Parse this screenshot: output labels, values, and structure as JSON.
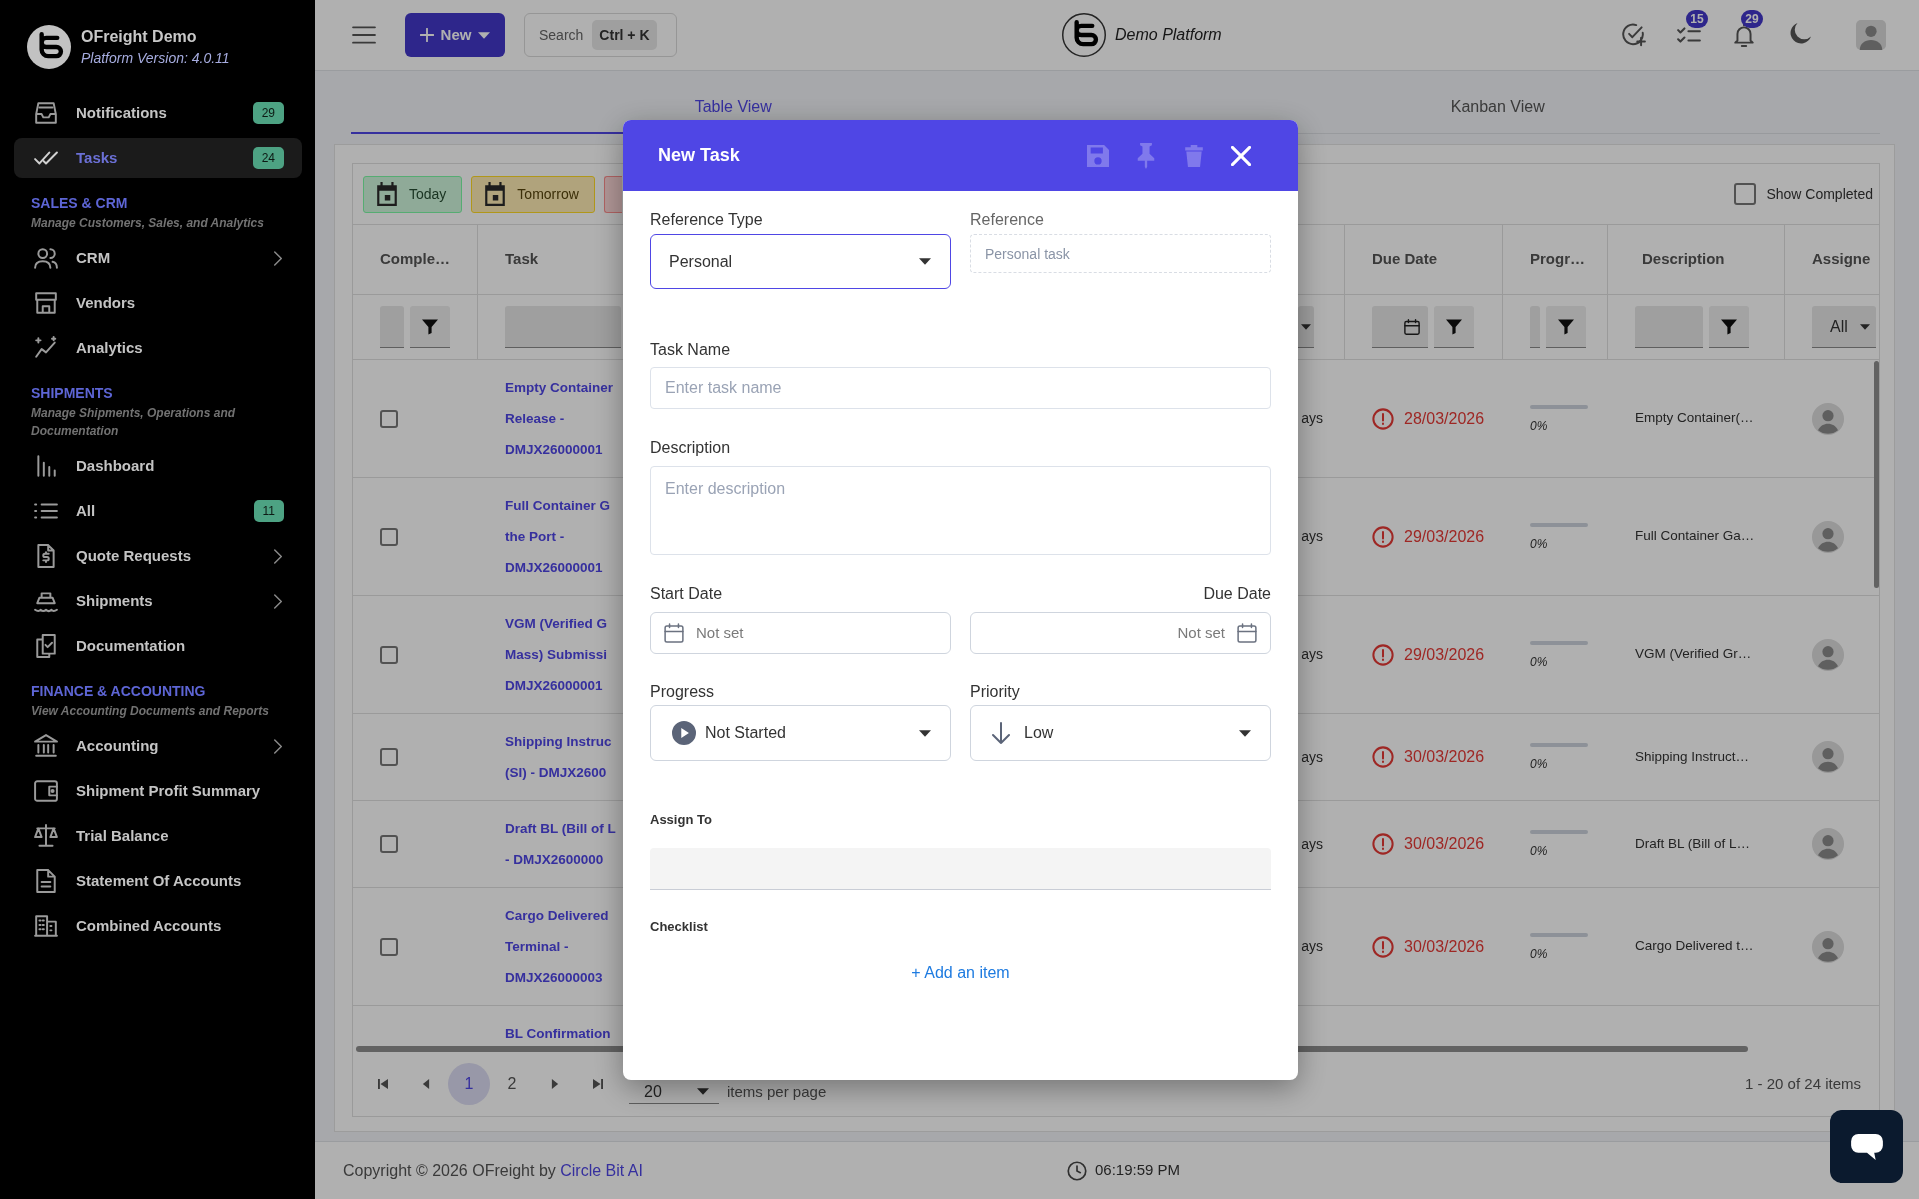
{
  "sidebar": {
    "brand": {
      "title": "OFreight Demo",
      "version": "Platform Version: 4.0.11"
    },
    "sections": [
      {
        "items": [
          {
            "label": "Notifications",
            "badge": "29",
            "selected": false,
            "submenu": false
          },
          {
            "label": "Tasks",
            "badge": "24",
            "selected": true,
            "submenu": false
          }
        ]
      },
      {
        "heading": "SALES & CRM",
        "subtitle": "Manage Customers, Sales, and Analytics",
        "items": [
          {
            "label": "CRM",
            "selected": false,
            "submenu": true
          },
          {
            "label": "Vendors",
            "selected": false,
            "submenu": false
          },
          {
            "label": "Analytics",
            "selected": false,
            "submenu": false
          }
        ]
      },
      {
        "heading": "SHIPMENTS",
        "subtitle": "Manage Shipments, Operations and Documentation",
        "items": [
          {
            "label": "Dashboard",
            "selected": false,
            "submenu": false
          },
          {
            "label": "All",
            "badge": "11",
            "selected": false,
            "submenu": false
          },
          {
            "label": "Quote Requests",
            "selected": false,
            "submenu": true
          },
          {
            "label": "Shipments",
            "selected": false,
            "submenu": true
          },
          {
            "label": "Documentation",
            "selected": false,
            "submenu": false
          }
        ]
      },
      {
        "heading": "FINANCE & ACCOUNTING",
        "subtitle": "View Accounting Documents and Reports",
        "items": [
          {
            "label": "Accounting",
            "selected": false,
            "submenu": true
          },
          {
            "label": "Shipment Profit Summary",
            "selected": false,
            "submenu": false
          },
          {
            "label": "Trial Balance",
            "selected": false,
            "submenu": false
          },
          {
            "label": "Statement Of Accounts",
            "selected": false,
            "submenu": false
          },
          {
            "label": "Combined Accounts",
            "selected": false,
            "submenu": false
          }
        ]
      }
    ]
  },
  "top_bar": {
    "new_button": "New",
    "search": {
      "label": "Search",
      "shortcut": "Ctrl + K"
    },
    "brand": "Demo Platform",
    "task_badge": "15",
    "notification_badge": "29"
  },
  "tabs": [
    {
      "label": "Table View",
      "selected": true
    },
    {
      "label": "Kanban View",
      "selected": false
    }
  ],
  "grid": {
    "quick_filters": [
      {
        "label": "Today",
        "color": "#8faa98"
      },
      {
        "label": "Tomorrow",
        "color": "#b0a37c"
      },
      {
        "color": "#b09696"
      }
    ],
    "show_completed": {
      "label": "Show Completed",
      "checked": false
    },
    "columns": [
      {
        "label": "Comple…",
        "filter": {
          "kind": "field_funnel"
        }
      },
      {
        "label": "Task",
        "filter": {
          "kind": "field"
        }
      },
      {
        "filter": {
          "kind": "dropdown"
        }
      },
      {
        "label": "Due Date",
        "filter": {
          "kind": "date_funnel"
        }
      },
      {
        "label": "Progr…",
        "filter": {
          "kind": "field_funnel"
        }
      },
      {
        "label": "Description",
        "filter": {
          "kind": "field_funnel"
        }
      },
      {
        "label": "Assigne",
        "filter": {
          "kind": "dropdown",
          "value": "All"
        }
      }
    ],
    "rows": [
      {
        "completed": false,
        "task": "Empty Container Release - DMJX26000001",
        "column_3": "ays",
        "overdue": true,
        "due_date": "28/03/2026",
        "progress": {
          "level": 0,
          "reading": "0%"
        },
        "description": "Empty Container(…"
      },
      {
        "completed": false,
        "task": "Full Container G the Port - DMJX26000001",
        "column_3": "ays",
        "overdue": true,
        "due_date": "29/03/2026",
        "progress": {
          "level": 0,
          "reading": "0%"
        },
        "description": "Full Container Ga…"
      },
      {
        "completed": false,
        "task": "VGM (Verified G Mass) Submissi DMJX26000001",
        "column_3": "ays",
        "overdue": true,
        "due_date": "29/03/2026",
        "progress": {
          "level": 0,
          "reading": "0%"
        },
        "description": "VGM (Verified Gr…"
      },
      {
        "completed": false,
        "task": "Shipping Instruc (SI) - DMJX2600",
        "column_3": "ays",
        "overdue": true,
        "due_date": "30/03/2026",
        "progress": {
          "level": 0,
          "reading": "0%"
        },
        "description": "Shipping Instruct…"
      },
      {
        "completed": false,
        "task": "Draft BL (Bill of L - DMJX2600000",
        "column_3": "ays",
        "overdue": true,
        "due_date": "30/03/2026",
        "progress": {
          "level": 0,
          "reading": "0%"
        },
        "description": "Draft BL (Bill of L…"
      },
      {
        "completed": false,
        "task": "Cargo Delivered Terminal - DMJX26000003",
        "column_3": "ays",
        "overdue": true,
        "due_date": "30/03/2026",
        "progress": {
          "level": 0,
          "reading": "0%"
        },
        "description": "Cargo Delivered t…"
      },
      {
        "task": "BL Confirmation"
      }
    ],
    "pager": {
      "pages": [
        {
          "label": "1",
          "selected": true
        },
        {
          "label": "2",
          "selected": false
        }
      ],
      "page_size": "20",
      "page_size_label": "items per page",
      "summary": "1 - 20 of 24 items"
    }
  },
  "footer": {
    "copyright": "Copyright © 2026 OFreight by",
    "link": "Circle Bit AI",
    "time": "06:19:59 PM"
  },
  "modal": {
    "title": "New Task",
    "header_buttons": [
      {
        "disabled": true
      },
      {
        "disabled": true
      },
      {
        "disabled": true
      },
      {
        "disabled": false
      }
    ],
    "reference_type": {
      "label": "Reference Type",
      "value": "Personal",
      "focused": true
    },
    "reference": {
      "label": "Reference",
      "placeholder": "Personal task",
      "disabled": true
    },
    "task_name": {
      "label": "Task Name",
      "placeholder": "Enter task name"
    },
    "description": {
      "label": "Description",
      "placeholder": "Enter description"
    },
    "start_date": {
      "label": "Start Date",
      "placeholder": "Not set"
    },
    "due_date": {
      "label": "Due Date",
      "placeholder": "Not set"
    },
    "progress": {
      "label": "Progress",
      "value": "Not Started"
    },
    "priority": {
      "label": "Priority",
      "value": "Low"
    },
    "assign_to": {
      "label": "Assign To"
    },
    "checklist": {
      "label": "Checklist",
      "add_link": "+ Add an item"
    }
  }
}
